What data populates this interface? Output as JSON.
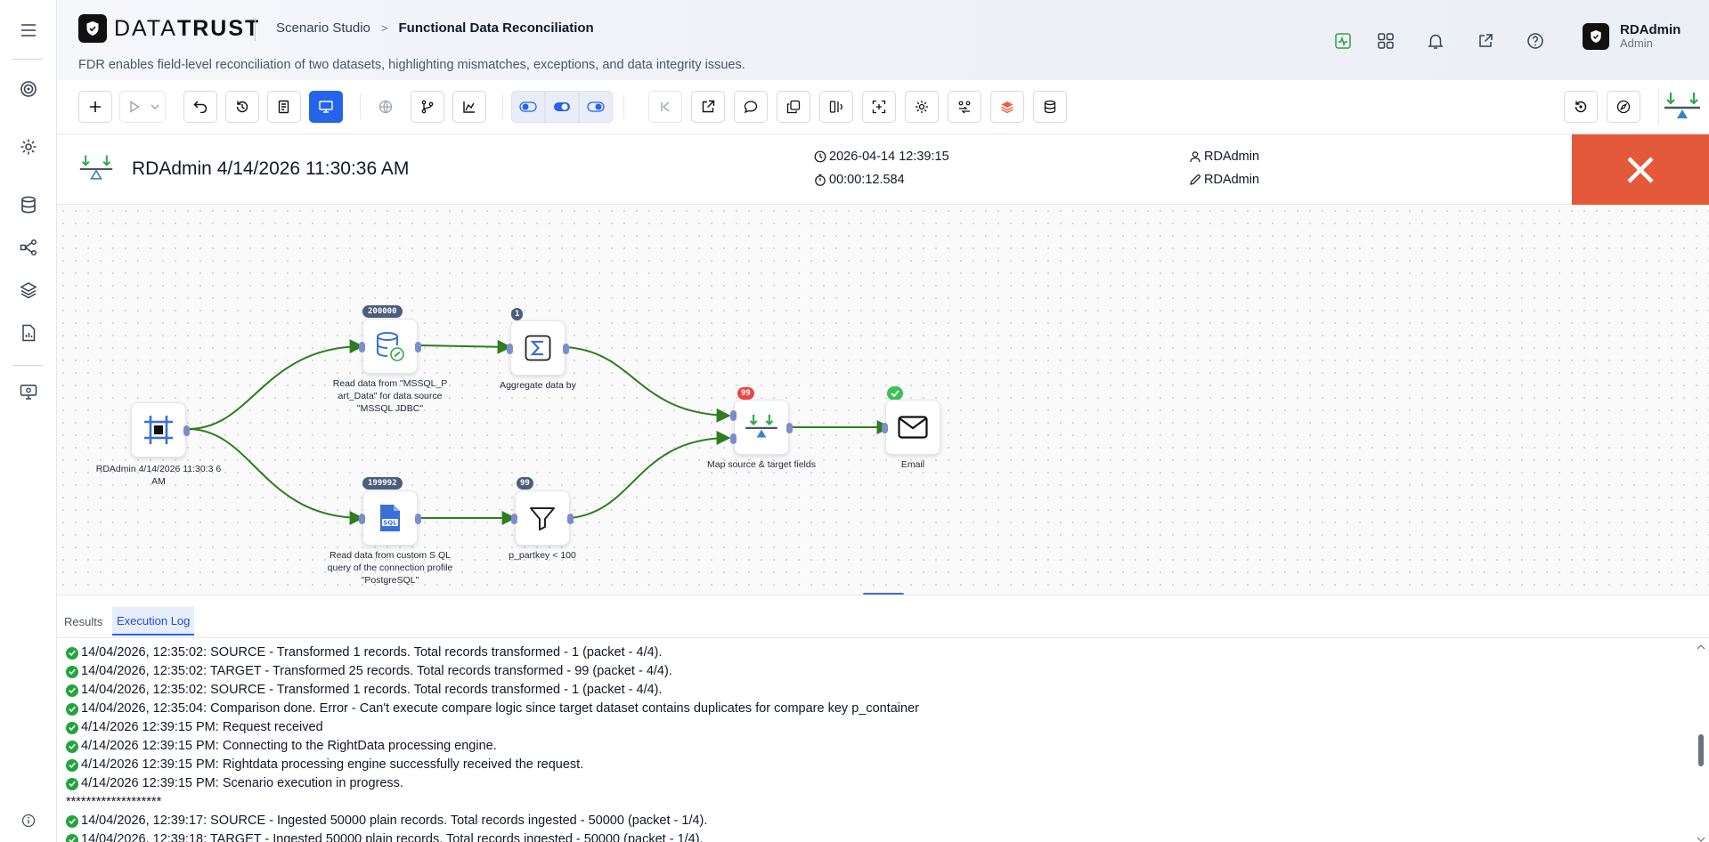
{
  "app": {
    "brand_light": "DATA",
    "brand_bold": "TRUST",
    "breadcrumb_parent": "Scenario Studio",
    "breadcrumb_separator": ">",
    "breadcrumb_current": "Functional Data Reconciliation",
    "subtitle": "FDR enables field-level reconciliation of two datasets, highlighting mismatches, exceptions, and data integrity issues.",
    "user_name": "RDAdmin",
    "user_role": "Admin"
  },
  "sidebar": {
    "items": [
      "menu-icon",
      "target-icon",
      "settings-icon",
      "database-icon",
      "workflow-icon",
      "layers-icon",
      "report-icon",
      "monitor-icon",
      "info-icon"
    ]
  },
  "header_icons": [
    "activity-icon",
    "apps-grid-icon",
    "bell-icon",
    "external-link-icon",
    "help-icon"
  ],
  "run": {
    "title": "RDAdmin 4/14/2026 11:30:36 AM",
    "start_time": "2026-04-14 12:39:15",
    "duration": "00:00:12.584",
    "created_by": "RDAdmin",
    "modified_by": "RDAdmin"
  },
  "flow": {
    "nodes": [
      {
        "id": "start",
        "label": "RDAdmin 4/14/2026 11:30:3 6 AM",
        "icon": "frame-icon",
        "badge": ""
      },
      {
        "id": "source",
        "label": "Read data from \"MSSQL_P art_Data\" for data source \"MSSQL JDBC\"",
        "icon": "database-link-icon",
        "badge": "200000"
      },
      {
        "id": "aggregate",
        "label": "Aggregate data by",
        "icon": "sigma-icon",
        "badge": "1"
      },
      {
        "id": "target",
        "label": "Read data from custom S QL query of the connection profile \"PostgreSQL\"",
        "icon": "sql-file-icon",
        "badge": "199992"
      },
      {
        "id": "filter",
        "label": "p_partkey < 100",
        "icon": "filter-icon",
        "badge": "99"
      },
      {
        "id": "map",
        "label": "Map source & target fields",
        "icon": "scale-icon",
        "badge": "99"
      },
      {
        "id": "email",
        "label": "Email",
        "icon": "mail-icon",
        "badge": "✓"
      }
    ]
  },
  "panel": {
    "tabs": [
      "Results",
      "Execution Log"
    ],
    "active_tab": "Execution Log",
    "log": [
      {
        "check": true,
        "text": "14/04/2026, 12:35:02: SOURCE - Transformed 1 records. Total records transformed - 1 (packet - 4/4)."
      },
      {
        "check": true,
        "text": "14/04/2026, 12:35:02: TARGET - Transformed 25 records. Total records transformed - 99 (packet - 4/4)."
      },
      {
        "check": true,
        "text": "14/04/2026, 12:35:02: SOURCE - Transformed 1 records. Total records transformed - 1 (packet - 4/4)."
      },
      {
        "check": true,
        "text": "14/04/2026, 12:35:04: Comparison done. Error - Can't execute compare logic since target dataset contains duplicates for compare key p_container"
      },
      {
        "check": true,
        "text": "4/14/2026 12:39:15 PM: Request received"
      },
      {
        "check": true,
        "text": "4/14/2026 12:39:15 PM: Connecting to the RightData processing engine."
      },
      {
        "check": true,
        "text": "4/14/2026 12:39:15 PM: Rightdata processing engine successfully received the request."
      },
      {
        "check": true,
        "text": "4/14/2026 12:39:15 PM: Scenario execution in progress."
      },
      {
        "check": false,
        "text": "*******************"
      },
      {
        "check": true,
        "text": "14/04/2026, 12:39:17: SOURCE - Ingested 50000 plain records. Total records ingested - 50000 (packet - 1/4)."
      },
      {
        "check": true,
        "text": "14/04/2026, 12:39:18: TARGET - Ingested 50000 plain records. Total records ingested - 50000 (packet - 1/4)."
      }
    ]
  },
  "colors": {
    "accent": "#2563eb",
    "close": "#e4593a",
    "edge": "#2e7d1e",
    "success": "#22a53c"
  }
}
